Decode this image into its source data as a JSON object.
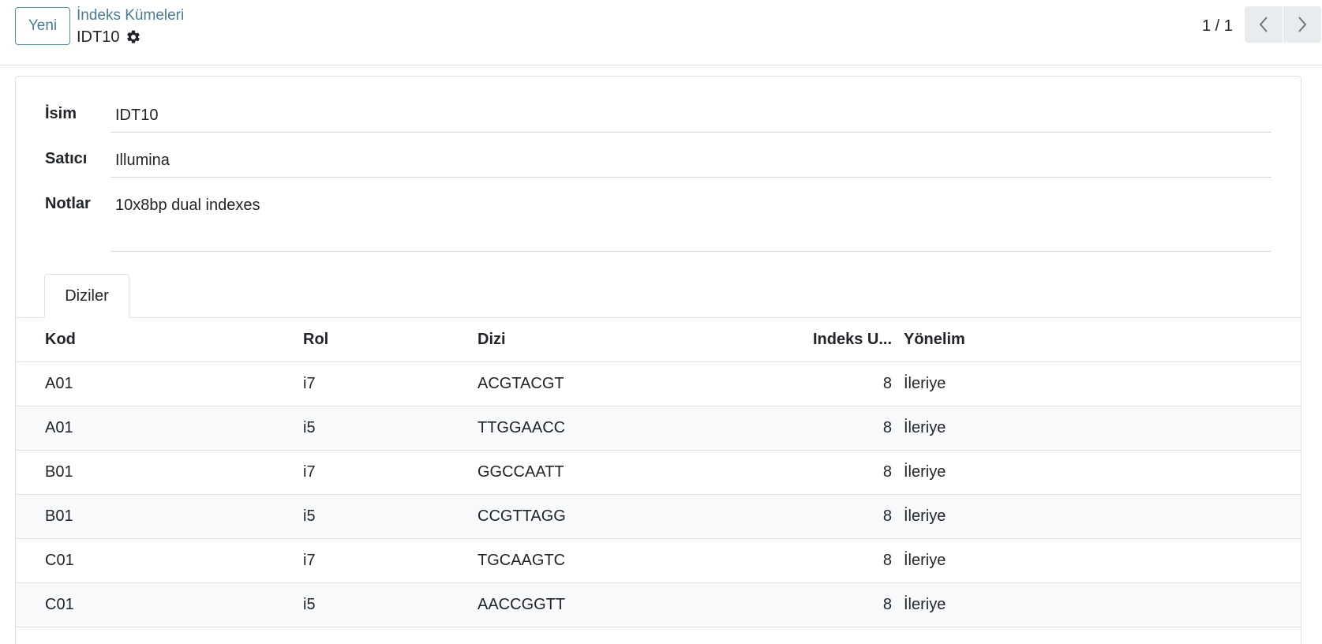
{
  "control_panel": {
    "new_button": "Yeni",
    "breadcrumb_parent": "İndeks Kümeleri",
    "breadcrumb_current": "IDT10",
    "pager_value": "1 / 1"
  },
  "icons": {
    "settings": "gear-icon",
    "previous": "chevron-left-icon",
    "next": "chevron-right-icon"
  },
  "form": {
    "name_label": "İsim",
    "name_value": "IDT10",
    "vendor_label": "Satıcı",
    "vendor_value": "Illumina",
    "notes_label": "Notlar",
    "notes_value": "10x8bp dual indexes"
  },
  "tabs": [
    {
      "label": "Diziler"
    }
  ],
  "table": {
    "headers": {
      "code": "Kod",
      "role": "Rol",
      "sequence": "Dizi",
      "index_length": "Indeks U...",
      "orientation": "Yönelim"
    },
    "rows": [
      {
        "code": "A01",
        "role": "i7",
        "sequence": "ACGTACGT",
        "index_length": "8",
        "orientation": "İleriye"
      },
      {
        "code": "A01",
        "role": "i5",
        "sequence": "TTGGAACC",
        "index_length": "8",
        "orientation": "İleriye"
      },
      {
        "code": "B01",
        "role": "i7",
        "sequence": "GGCCAATT",
        "index_length": "8",
        "orientation": "İleriye"
      },
      {
        "code": "B01",
        "role": "i5",
        "sequence": "CCGTTAGG",
        "index_length": "8",
        "orientation": "İleriye"
      },
      {
        "code": "C01",
        "role": "i7",
        "sequence": "TGCAAGTC",
        "index_length": "8",
        "orientation": "İleriye"
      },
      {
        "code": "C01",
        "role": "i5",
        "sequence": "AACCGGTT",
        "index_length": "8",
        "orientation": "İleriye"
      }
    ]
  }
}
